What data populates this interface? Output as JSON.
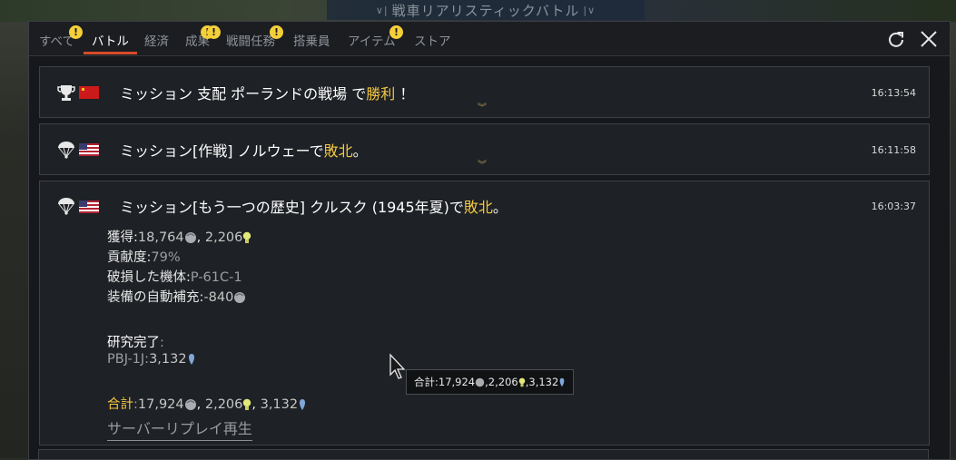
{
  "top_banner": {
    "mode_label": "戦車リアリスティックバトル"
  },
  "tabs": [
    {
      "label": "すべて",
      "alert": false
    },
    {
      "label": "バトル",
      "alert": true,
      "active": true
    },
    {
      "label": "経済",
      "alert": false
    },
    {
      "label": "成果",
      "alert": true
    },
    {
      "label": "戦闘任務",
      "alert": true
    },
    {
      "label": "搭乗員",
      "alert": true
    },
    {
      "label": "アイテム",
      "alert": true
    },
    {
      "label": "ストア",
      "alert": false
    }
  ],
  "tab_alert_glyph": "!",
  "toolbar": {
    "refresh_icon": "refresh-icon",
    "close_icon": "close-icon"
  },
  "entries": [
    {
      "icon": "trophy-icon",
      "flag": "ussr-flag",
      "title_prefix": "ミッション 支配 ポーランドの戦場 で",
      "result": "勝利",
      "title_suffix": " ！",
      "time": "16:13:54"
    },
    {
      "icon": "parachute-icon",
      "flag": "usa-flag",
      "title_prefix": "ミッション[作戦] ノルウェーで",
      "result": "敗北",
      "title_suffix": "。",
      "time": "16:11:58"
    },
    {
      "icon": "parachute-icon",
      "flag": "usa-flag",
      "title_prefix": "ミッション[もう一つの歴史] クルスク (1945年夏)で",
      "result": "敗北",
      "title_suffix": "。",
      "time": "16:03:37",
      "details": {
        "earned_label": "獲得:",
        "earned_lions": "18,764",
        "earned_sep": ", ",
        "earned_rp": "2,206",
        "contribution_label": "貢献度:",
        "contribution_value": "79%",
        "destroyed_label": "破損した機体:",
        "destroyed_value": "P-61C-1",
        "auto_repair_label": "装備の自動補充:",
        "auto_repair_value": "-840",
        "research_label": "研究完了",
        "research_colon": ":",
        "research_item": "PBJ-1J:",
        "research_value": "3,132",
        "total_label": "合計",
        "total_colon": ":",
        "total_lions": "17,924",
        "total_rp": "2,206",
        "total_research": "3,132",
        "replay_label": "サーバーリプレイ再生"
      }
    }
  ],
  "tooltip": {
    "label": "合計:",
    "lions": "17,924",
    "rp": "2,206",
    "research": "3,132",
    "sep": ", "
  },
  "colors": {
    "accent": "#d94a2a",
    "highlight": "#f5c842",
    "alert": "#f4cf3a"
  }
}
